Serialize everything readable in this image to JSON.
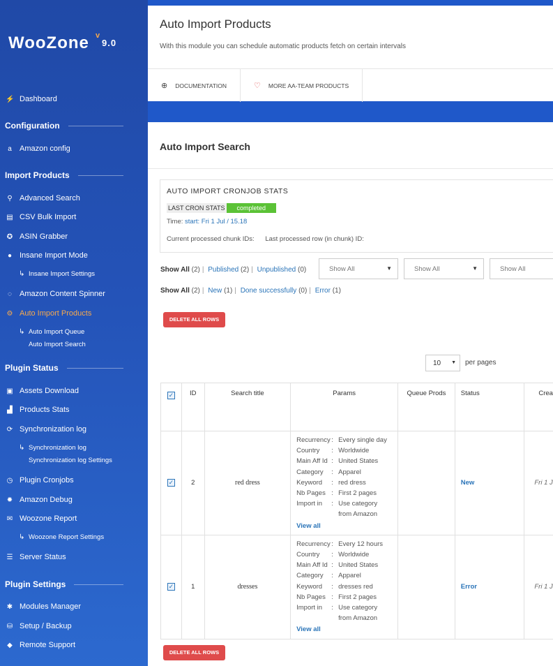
{
  "brand": {
    "name": "WooZone",
    "v": "v",
    "version": "9.0"
  },
  "sidebar": {
    "dashboard": "Dashboard",
    "sections": [
      "Configuration",
      "Import Products",
      "Plugin Status",
      "Plugin Settings"
    ],
    "items": {
      "amazon_config": "Amazon config",
      "advanced_search": "Advanced Search",
      "csv_bulk_import": "CSV Bulk Import",
      "asin_grabber": "ASIN Grabber",
      "insane_import_mode": "Insane Import Mode",
      "insane_import_settings": "Insane Import Settings",
      "amazon_content_spinner": "Amazon Content Spinner",
      "auto_import_products": "Auto Import Products",
      "auto_import_queue": "Auto Import Queue",
      "auto_import_search": "Auto Import Search",
      "assets_download": "Assets Download",
      "products_stats": "Products Stats",
      "synchronization_log": "Synchronization log",
      "synchronization_log_sub": "Synchronization log",
      "synchronization_log_settings": "Synchronization log Settings",
      "plugin_cronjobs": "Plugin Cronjobs",
      "amazon_debug": "Amazon Debug",
      "woozone_report": "Woozone Report",
      "woozone_report_settings": "Woozone Report Settings",
      "server_status": "Server Status",
      "modules_manager": "Modules Manager",
      "setup_backup": "Setup / Backup",
      "remote_support": "Remote Support"
    }
  },
  "header": {
    "title": "Auto Import Products",
    "subtitle": "With this module you can schedule automatic products fetch on certain intervals",
    "links": {
      "documentation": "DOCUMENTATION",
      "more_products": "MORE AA-TEAM PRODUCTS"
    }
  },
  "main": {
    "title": "Auto Import Search",
    "stats": {
      "title": "AUTO IMPORT CRONJOB STATS",
      "last_label": "LAST CRON STATS",
      "last_value": "completed",
      "time_label": "Time:",
      "time_value": "start: Fri 1 Jul / 15.18",
      "chunk_ids": "Current processed chunk IDs:",
      "last_row": "Last processed row (in chunk) ID:"
    },
    "filter1": {
      "show_all": "Show All",
      "show_all_count": "(2)",
      "published": "Published",
      "published_count": "(2)",
      "unpublished": "Unpublished",
      "unpublished_count": "(0)"
    },
    "selects": [
      "Show All",
      "Show All",
      "Show All"
    ],
    "filter2": {
      "show_all": "Show All",
      "show_all_count": "(2)",
      "new": "New",
      "new_count": "(1)",
      "done": "Done successfully",
      "done_count": "(0)",
      "error": "Error",
      "error_count": "(1)"
    },
    "delete_all": "DELETE ALL ROWS",
    "per_page_value": "10",
    "per_page_label": "per pages",
    "table": {
      "headers": {
        "id": "ID",
        "search_title": "Search title",
        "params": "Params",
        "queue_prods": "Queue Prods",
        "status": "Status",
        "created": "Crea"
      },
      "param_keys": [
        "Recurrency",
        "Country",
        "Main Aff Id",
        "Category",
        "Keyword",
        "Nb Pages",
        "Import in"
      ],
      "view_all": "View all",
      "rows": [
        {
          "id": "2",
          "search_title": "red  dress",
          "status": "New",
          "created": "Fri 1 J",
          "params": [
            "Every single day",
            "Worldwide",
            "United States",
            "Apparel",
            "red dress",
            "First 2 pages",
            "Use category from Amazon"
          ]
        },
        {
          "id": "1",
          "search_title": "dresses",
          "status": "Error",
          "created": "Fri 1 J",
          "params": [
            "Every 12 hours",
            "Worldwide",
            "United States",
            "Apparel",
            "dresses red",
            "First 2 pages",
            "Use category from Amazon"
          ]
        }
      ]
    }
  }
}
